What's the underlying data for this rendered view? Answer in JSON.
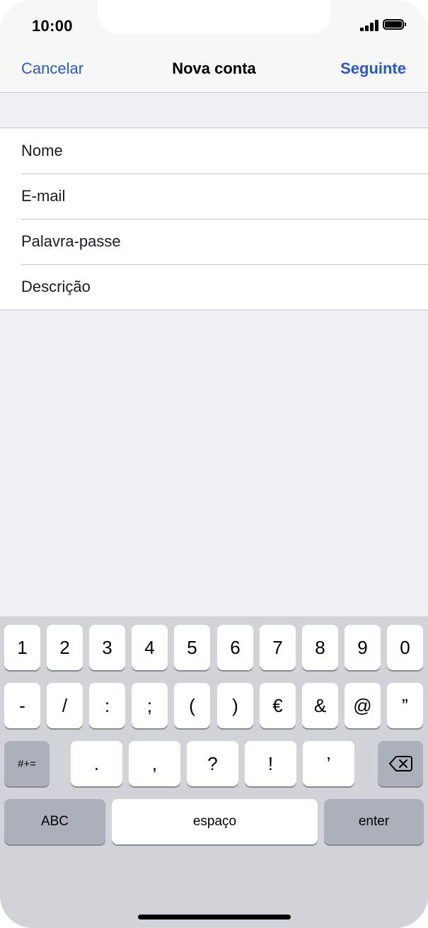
{
  "status_bar": {
    "time": "10:00",
    "signal_icon": "cellular-signal-icon",
    "battery_icon": "battery-icon",
    "battery_level": 1.0
  },
  "nav": {
    "cancel_label": "Cancelar",
    "title": "Nova conta",
    "next_label": "Seguinte",
    "accent_color": "#2a59c6"
  },
  "form": {
    "fields": [
      {
        "placeholder": "Nome"
      },
      {
        "placeholder": "E-mail"
      },
      {
        "placeholder": "Palavra-passe"
      },
      {
        "placeholder": "Descrição"
      }
    ]
  },
  "keyboard": {
    "row1": [
      "1",
      "2",
      "3",
      "4",
      "5",
      "6",
      "7",
      "8",
      "9",
      "0"
    ],
    "row2": [
      "-",
      "/",
      ":",
      ";",
      "(",
      ")",
      "€",
      "&",
      "@",
      "”"
    ],
    "row3": {
      "shift_label": "#+=",
      "keys": [
        ".",
        ",",
        "?",
        "!",
        "’"
      ],
      "delete_icon": "backspace-icon"
    },
    "row4": {
      "abc_label": "ABC",
      "space_label": "espaço",
      "enter_label": "enter"
    }
  }
}
